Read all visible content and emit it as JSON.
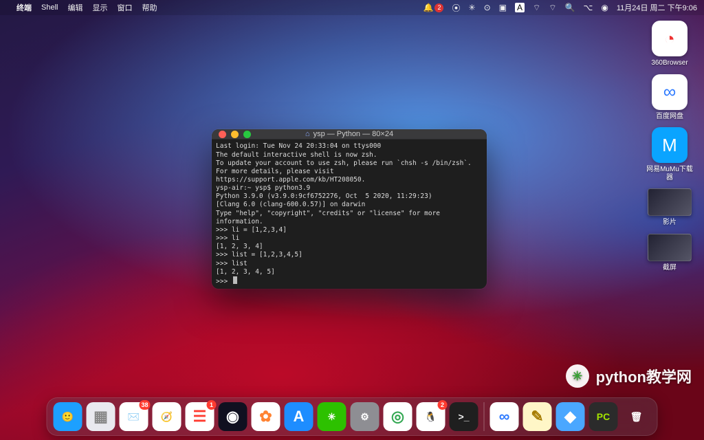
{
  "menubar": {
    "app": "终端",
    "items": [
      "Shell",
      "编辑",
      "显示",
      "窗口",
      "帮助"
    ],
    "notif_count": "2",
    "clock": "11月24日 周二 下午9:06"
  },
  "desktop": [
    {
      "label": "360Browser",
      "bg": "#ffffff",
      "glyph": "◔",
      "fg": "#e33"
    },
    {
      "label": "百度网盘",
      "bg": "#ffffff",
      "glyph": "∞",
      "fg": "#2f7bff"
    },
    {
      "label": "网易MuMu下载器",
      "bg": "#0aa4ff",
      "glyph": "M",
      "fg": "#fff"
    },
    {
      "label": "影片",
      "thumb": true
    },
    {
      "label": "截屏",
      "thumb": true
    }
  ],
  "terminal": {
    "title": "ysp — Python — 80×24",
    "lines": [
      "Last login: Tue Nov 24 20:33:04 on ttys000",
      "",
      "The default interactive shell is now zsh.",
      "To update your account to use zsh, please run `chsh -s /bin/zsh`.",
      "For more details, please visit https://support.apple.com/kb/HT208050.",
      "ysp-air:~ ysp$ python3.9",
      "Python 3.9.0 (v3.9.0:9cf6752276, Oct  5 2020, 11:29:23)",
      "[Clang 6.0 (clang-600.0.57)] on darwin",
      "Type \"help\", \"copyright\", \"credits\" or \"license\" for more information.",
      ">>> li = [1,2,3,4]",
      ">>> li",
      "[1, 2, 3, 4]",
      ">>> list = [1,2,3,4,5]",
      ">>> list",
      "[1, 2, 3, 4, 5]",
      ">>> "
    ]
  },
  "dock": [
    {
      "name": "finder",
      "glyph": "🙂",
      "bg": "#1da0ff"
    },
    {
      "name": "launchpad",
      "glyph": "▦",
      "bg": "#e9e9ef",
      "fg": "#888"
    },
    {
      "name": "mail",
      "glyph": "✉️",
      "bg": "#ffffff",
      "badge": "38"
    },
    {
      "name": "safari",
      "glyph": "🧭",
      "bg": "#ffffff"
    },
    {
      "name": "reminders",
      "glyph": "☰",
      "bg": "#ffffff",
      "fg": "#ff3b30",
      "badge": "1"
    },
    {
      "name": "siri",
      "glyph": "◉",
      "bg": "#101020"
    },
    {
      "name": "photos",
      "glyph": "✿",
      "bg": "#ffffff",
      "fg": "#ff8333"
    },
    {
      "name": "appstore",
      "glyph": "A",
      "bg": "#1e8dff"
    },
    {
      "name": "wechat",
      "glyph": "✳︎",
      "bg": "#2dc100"
    },
    {
      "name": "settings",
      "glyph": "⚙︎",
      "bg": "#8e8e93"
    },
    {
      "name": "chrome",
      "glyph": "◎",
      "bg": "#ffffff",
      "fg": "#34a853"
    },
    {
      "name": "qq",
      "glyph": "🐧",
      "bg": "#ffffff",
      "badge": "2"
    },
    {
      "name": "terminal",
      "glyph": ">_",
      "bg": "#1f1f1f",
      "fg": "#eee"
    },
    {
      "sep": true
    },
    {
      "name": "baidupan",
      "glyph": "∞",
      "bg": "#ffffff",
      "fg": "#2f7bff"
    },
    {
      "name": "notes",
      "glyph": "✎",
      "bg": "#fff6c7",
      "fg": "#a67c00"
    },
    {
      "name": "qqbrowser",
      "glyph": "◆",
      "bg": "#4aa7ff"
    },
    {
      "name": "pycharm",
      "glyph": "PC",
      "bg": "#2b2b2b",
      "fg": "#a4e400"
    },
    {
      "name": "trash",
      "glyph": "🗑",
      "bg": "transparent"
    }
  ],
  "watermark": "python教学网"
}
